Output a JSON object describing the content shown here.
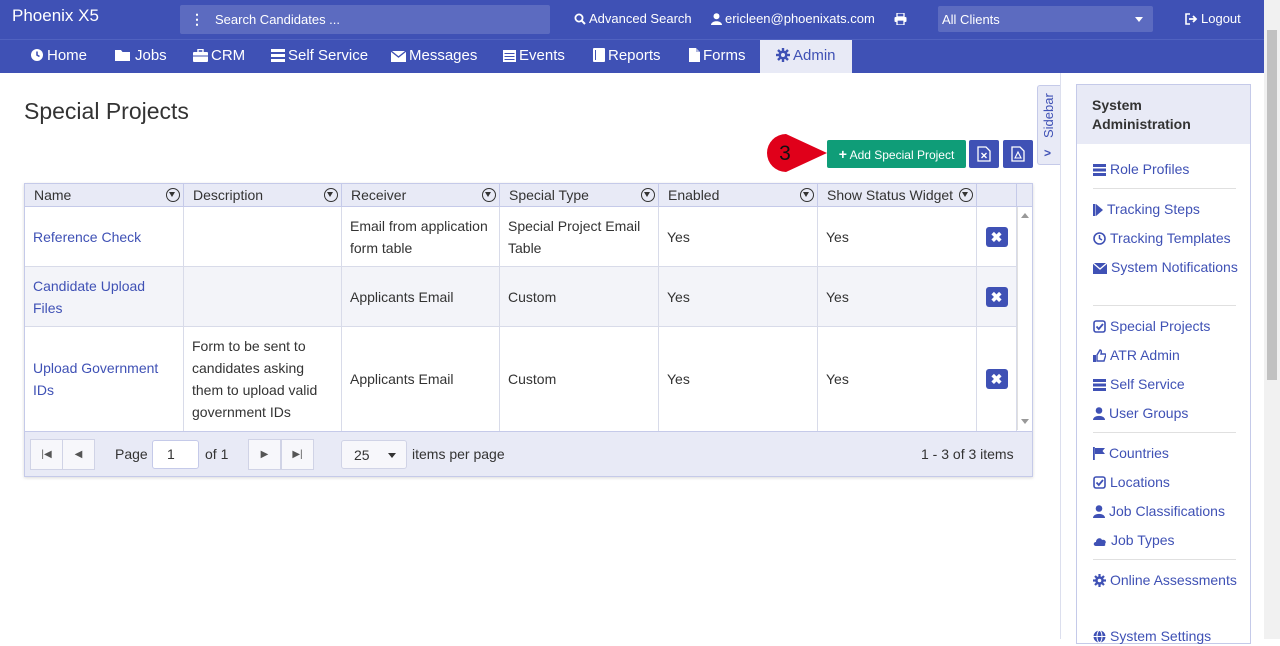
{
  "topbar": {
    "brand": "Phoenix X5",
    "search_placeholder": "Search Candidates ...",
    "advanced_search": "Advanced Search",
    "user": "ericleen@phoenixats.com",
    "client_select": "All Clients",
    "logout": "Logout"
  },
  "nav": {
    "items": [
      {
        "label": "Home",
        "icon": "clock-icon"
      },
      {
        "label": "Jobs",
        "icon": "folder-icon"
      },
      {
        "label": "CRM",
        "icon": "briefcase-icon"
      },
      {
        "label": "Self Service",
        "icon": "list-icon"
      },
      {
        "label": "Messages",
        "icon": "envelope-icon"
      },
      {
        "label": "Events",
        "icon": "calendar-icon"
      },
      {
        "label": "Reports",
        "icon": "book-icon"
      },
      {
        "label": "Forms",
        "icon": "file-icon"
      },
      {
        "label": "Admin",
        "icon": "gear-icon"
      }
    ],
    "active": "Admin"
  },
  "page": {
    "title": "Special Projects",
    "add_button": "Add Special Project",
    "step_number": "3"
  },
  "grid": {
    "columns": [
      "Name",
      "Description",
      "Receiver",
      "Special Type",
      "Enabled",
      "Show Status Widget"
    ],
    "rows": [
      {
        "name": "Reference Check",
        "description": "",
        "receiver": "Email from application form table",
        "special_type": "Special Project Email Table",
        "enabled": "Yes",
        "show_status_widget": "Yes"
      },
      {
        "name": "Candidate Upload Files",
        "description": "",
        "receiver": "Applicants Email",
        "special_type": "Custom",
        "enabled": "Yes",
        "show_status_widget": "Yes"
      },
      {
        "name": "Upload Government IDs",
        "description": "Form to be sent to candidates asking them to upload valid government IDs",
        "receiver": "Applicants Email",
        "special_type": "Custom",
        "enabled": "Yes",
        "show_status_widget": "Yes"
      }
    ],
    "pager": {
      "page_label": "Page",
      "page_value": "1",
      "of_label": "of 1",
      "page_size": "25",
      "items_per_page": "items per page",
      "summary": "1 - 3 of 3 items"
    }
  },
  "sidebar": {
    "toggle_label": "Sidebar",
    "heading": "System Administration",
    "groups": [
      [
        {
          "label": "Role Profiles",
          "icon": "list-icon"
        }
      ],
      [
        {
          "label": "Tracking Steps",
          "icon": "step-forward-icon"
        },
        {
          "label": "Tracking Templates",
          "icon": "clock-icon"
        },
        {
          "label": "System Notifications",
          "icon": "envelope-icon"
        }
      ],
      [
        {
          "label": "Special Projects",
          "icon": "check-square-icon"
        },
        {
          "label": "ATR Admin",
          "icon": "thumbs-up-icon"
        },
        {
          "label": "Self Service",
          "icon": "list-icon"
        },
        {
          "label": "User Groups",
          "icon": "user-icon"
        }
      ],
      [
        {
          "label": "Countries",
          "icon": "flag-icon"
        },
        {
          "label": "Locations",
          "icon": "check-square-icon"
        },
        {
          "label": "Job Classifications",
          "icon": "user-icon"
        },
        {
          "label": "Job Types",
          "icon": "cloud-icon"
        }
      ],
      [
        {
          "label": "Online Assessments",
          "icon": "gear-icon"
        },
        {
          "label": "System Settings",
          "icon": "globe-icon"
        }
      ]
    ]
  },
  "colors": {
    "primary": "#3f51b5",
    "success": "#0f9d78",
    "highlight_bubble": "#e0001a"
  }
}
